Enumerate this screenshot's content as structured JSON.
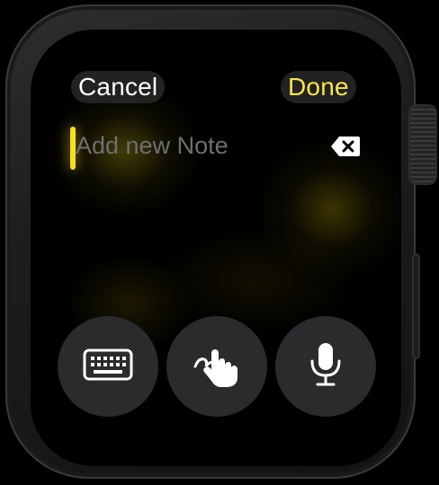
{
  "header": {
    "cancel_label": "Cancel",
    "done_label": "Done"
  },
  "note_field": {
    "placeholder": "Add new Note",
    "value": ""
  },
  "input_methods": [
    {
      "name": "keyboard",
      "icon": "keyboard-icon"
    },
    {
      "name": "scribble",
      "icon": "hand-scribble-icon"
    },
    {
      "name": "dictation",
      "icon": "microphone-icon"
    }
  ],
  "colors": {
    "accent": "#f9e64a",
    "cursor": "#f6df1e",
    "placeholder": "#6f6f71",
    "button_background": "#2b2b2d"
  }
}
